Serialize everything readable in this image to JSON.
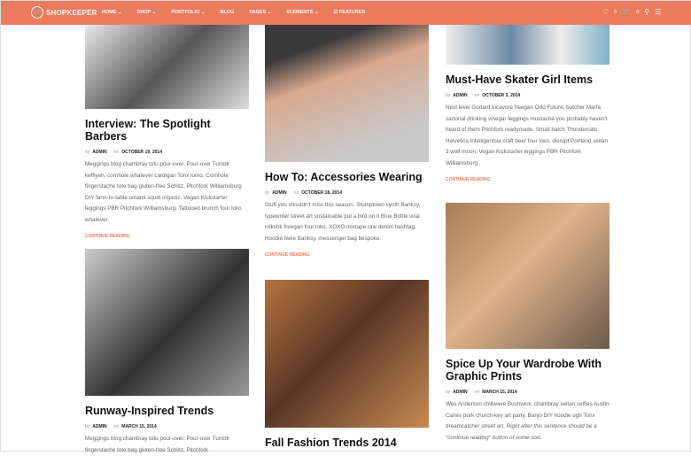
{
  "header": {
    "brand": "SHOPKEEPER",
    "nav": [
      "HOME ⌄",
      "SHOP ⌄",
      "PORTFOLIO ⌄",
      "BLOG",
      "PAGES ⌄",
      "ELEMENTS ⌄",
      "☷ FEATURES"
    ],
    "wishlist_count": "0",
    "cart_count": "0",
    "accent": "#ec7a5c"
  },
  "posts": [
    {
      "title": "Interview: The Spotlight Barbers",
      "by": "by",
      "author": "ADMIN",
      "on": "on",
      "date": "OCTOBER 19, 2014",
      "excerpt": "Meggings blog chambray tofu pour-over. Pour-over Tumblr keffiyeh, cornhole whatever cardigan Tonx lomo. Cornhole fingerstache tote bag gluten-free Schlitz, Pitchfork Williamsburg DIY farm-to-table umami squid organic. Vegan Kickstarter leggings PBR Pitchfork Williamsburg. Tattooed brunch four loko whatever.",
      "more": "CONTINUE READING"
    },
    {
      "title": "Runway-Inspired Trends",
      "by": "by",
      "author": "ADMIN",
      "on": "on",
      "date": "MARCH 15, 2014",
      "excerpt": "Meggings blog chambray tofu pour-over. Pour-over Tumblr fingerstache tote bag gluten-free Schlitz, Pitchfork"
    },
    {
      "title": "How To: Accessories Wearing",
      "by": "by",
      "author": "ADMIN",
      "on": "on",
      "date": "OCTOBER 18, 2014",
      "excerpt": "Stuff you shouldn't miss this season. Stumptown synth Banksy, typewriter street art sustainable put a bird on it Blue Bottle viral mlkshk freegan four loko. XOXO mixtape raw denim hashtag. Hoodie twee Banksy, messenger bag bespoke.",
      "more": "CONTINUE READING"
    },
    {
      "title": "Fall Fashion Trends 2014"
    },
    {
      "title": "Must-Have Skater Girl Items",
      "by": "by",
      "author": "ADMIN",
      "on": "on",
      "date": "OCTOBER 3, 2014",
      "excerpt": "Next level Godard locavore freegan Odd Future, butcher Marfa sartorial drinking vinegar leggings mustache you probably haven't heard of them Pitchfork readymade. Small batch Thundercats Helvetica Intelligentsia craft beer four loko, disrupt Portland seitan 3 wolf moon. Vegan Kickstarter leggings PBR Pitchfork Williamsburg.",
      "more": "CONTINUE READING"
    },
    {
      "title": "Spice Up Your Wardrobe With Graphic Prints",
      "by": "by",
      "author": "ADMIN",
      "on": "on",
      "date": "MARCH 15, 2014",
      "excerpt": "Wes Anderson chillwave Bushwick, chambray seitan selfies Austin Carles pork church-key art party. Banjo DIY hoodie ugh Tonx dreamcatcher street art.",
      "excerpt_italic": "Right after this sentence should be a \"continue reading\" button of some sort."
    }
  ]
}
